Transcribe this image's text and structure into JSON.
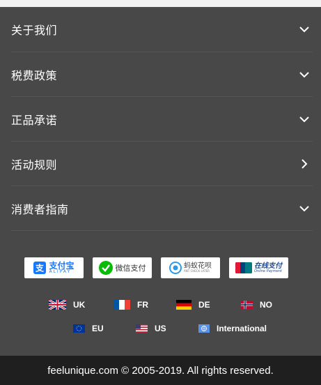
{
  "menu": {
    "items": [
      {
        "label": "关于我们",
        "chevron": "chevron-down-icon"
      },
      {
        "label": "税费政策",
        "chevron": "chevron-down-icon"
      },
      {
        "label": "正品承诺",
        "chevron": "chevron-down-icon"
      },
      {
        "label": "活动规则",
        "chevron": "chevron-right-icon"
      },
      {
        "label": "消费者指南",
        "chevron": "chevron-down-icon"
      }
    ]
  },
  "payments": [
    {
      "name": "alipay",
      "text": "支付宝",
      "subtext": "ALIPAY",
      "color": "#1677ff"
    },
    {
      "name": "wechat-pay",
      "text": "微信支付",
      "color": "#09bb07"
    },
    {
      "name": "huabei",
      "text": "蚂蚁花呗",
      "subtext": "ANT CHECK LATER",
      "color": "#2b9ae8"
    },
    {
      "name": "unionpay",
      "text": "在线支付",
      "subtext": "Online Payment",
      "color": "#1e4b9b"
    }
  ],
  "regions": {
    "row1": [
      {
        "code": "UK",
        "flag": "uk-flag-icon"
      },
      {
        "code": "FR",
        "flag": "france-flag-icon"
      },
      {
        "code": "DE",
        "flag": "germany-flag-icon"
      },
      {
        "code": "NO",
        "flag": "norway-flag-icon"
      }
    ],
    "row2": [
      {
        "code": "EU",
        "flag": "eu-flag-icon"
      },
      {
        "code": "US",
        "flag": "us-flag-icon"
      },
      {
        "code": "International",
        "flag": "globe-flag-icon"
      }
    ]
  },
  "footer": {
    "copyright": "feelunique.com © 2005-2019. All rights reserved."
  },
  "colors": {
    "panel_bg": "#484848",
    "footer_bg": "#1f1f1f",
    "text": "#ffffff"
  }
}
